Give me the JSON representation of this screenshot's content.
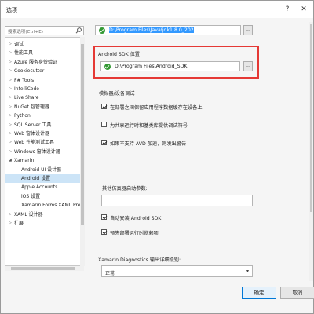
{
  "window": {
    "title": "选项",
    "help_glyph": "?",
    "close_glyph": "✕"
  },
  "search": {
    "placeholder": "搜索选项(Ctrl+E)"
  },
  "tree": {
    "items": [
      {
        "label": "调试",
        "arrow": "▷",
        "child": false
      },
      {
        "label": "性能工具",
        "arrow": "▷",
        "child": false
      },
      {
        "label": "Azure 服务身份验证",
        "arrow": "▷",
        "child": false
      },
      {
        "label": "Cookiecutter",
        "arrow": "▷",
        "child": false
      },
      {
        "label": "F# Tools",
        "arrow": "▷",
        "child": false
      },
      {
        "label": "IntelliCode",
        "arrow": "▷",
        "child": false
      },
      {
        "label": "Live Share",
        "arrow": "▷",
        "child": false
      },
      {
        "label": "NuGet 包管理器",
        "arrow": "▷",
        "child": false
      },
      {
        "label": "Python",
        "arrow": "▷",
        "child": false
      },
      {
        "label": "SQL Server 工具",
        "arrow": "▷",
        "child": false
      },
      {
        "label": "Web 窗体设计器",
        "arrow": "▷",
        "child": false
      },
      {
        "label": "Web 性能测试工具",
        "arrow": "▷",
        "child": false
      },
      {
        "label": "Windows 窗体设计器",
        "arrow": "▷",
        "child": false
      },
      {
        "label": "Xamarin",
        "arrow": "◢",
        "child": false
      },
      {
        "label": "Android UI 设计器",
        "arrow": "",
        "child": true
      },
      {
        "label": "Android 设置",
        "arrow": "",
        "child": true,
        "selected": true
      },
      {
        "label": "Apple Accounts",
        "arrow": "",
        "child": true
      },
      {
        "label": "iOS 设置",
        "arrow": "",
        "child": true
      },
      {
        "label": "Xamarin.Forms XAML Previewe",
        "arrow": "",
        "child": true
      },
      {
        "label": "XAML 设计器",
        "arrow": "▷",
        "child": false
      },
      {
        "label": "扩展",
        "arrow": "▷",
        "child": false
      }
    ]
  },
  "jdk": {
    "path": "D:\\Program Files\\Java\\jdk1.8.0_202",
    "browse": "..."
  },
  "android_sdk": {
    "label": "Android SDK 位置",
    "path": "D:\\Program Files\\Android_SDK",
    "browse": "..."
  },
  "emulator": {
    "heading": "模拟器/设备调试",
    "options": [
      {
        "label": "在部署之间保留应用程序数据缓存在设备上",
        "checked": true
      },
      {
        "label": "为共享运行时和基类库提供调试符号",
        "checked": false
      },
      {
        "label": "如果不支持 AVD 加速，则发出警告",
        "checked": true
      }
    ]
  },
  "emulator_args": {
    "label": "其他仿真器启动参数:",
    "value": ""
  },
  "misc_options": [
    {
      "label": "自动安装 Android SDK",
      "checked": true
    },
    {
      "label": "预先部署运行时依赖项",
      "checked": true
    }
  ],
  "diagnostics": {
    "label": "Xamarin Diagnostics 输出详细级别:",
    "value": "正常",
    "arrow": "▾"
  },
  "footer": {
    "ok": "确定",
    "cancel": "取消"
  }
}
